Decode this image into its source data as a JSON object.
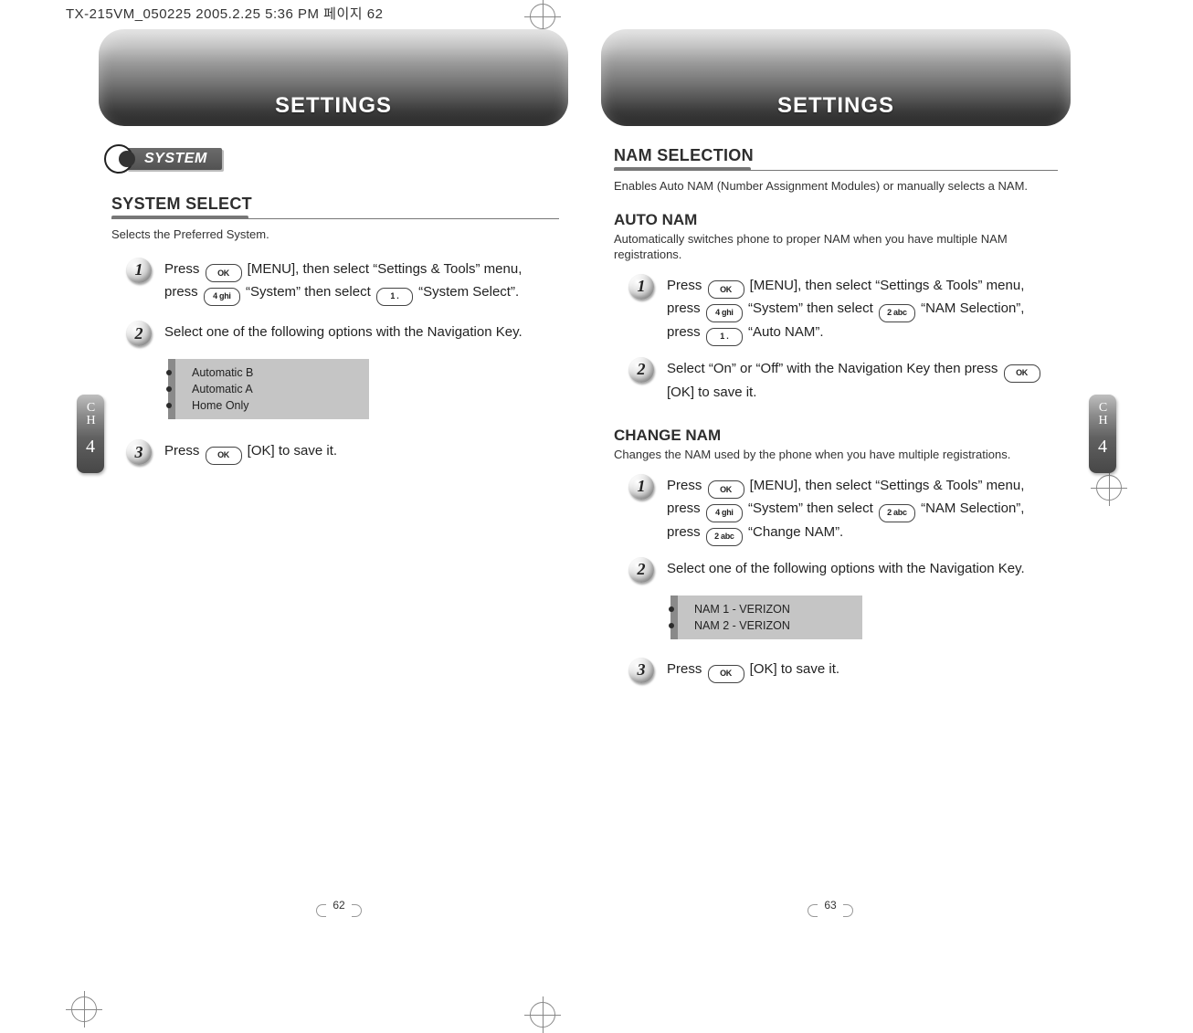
{
  "header_text": "TX-215VM_050225  2005.2.25 5:36 PM  페이지 62",
  "chapter_label": {
    "ch_line1": "C",
    "ch_line2": "H",
    "num": "4"
  },
  "left": {
    "banner": "SETTINGS",
    "section_tag": "SYSTEM",
    "sec_heading": "SYSTEM SELECT",
    "sec_desc": "Selects the Preferred System.",
    "step1": {
      "num": "1",
      "t1": "Press ",
      "t2": " [MENU], then select “Settings & Tools” menu, press ",
      "t3": " “System” then select ",
      "t4": " “System Select”."
    },
    "step2": {
      "num": "2",
      "text": "Select one of the following options with the Navigation Key."
    },
    "options": [
      "Automatic B",
      "Automatic A",
      "Home Only"
    ],
    "step3": {
      "num": "3",
      "t1": "Press ",
      "t2": " [OK] to save it."
    },
    "page_num": "62"
  },
  "right": {
    "banner": "SETTINGS",
    "sec_heading": "NAM SELECTION",
    "sec_desc": "Enables Auto NAM (Number Assignment Modules) or manually selects a NAM.",
    "auto_nam": {
      "heading": "AUTO NAM",
      "desc": "Automatically switches phone to proper NAM when you have multiple NAM registrations.",
      "step1": {
        "num": "1",
        "t1": "Press ",
        "t2": " [MENU], then select “Settings & Tools” menu, press ",
        "t3": " “System” then select ",
        "t4": " “NAM Selection”, press ",
        "t5": " “Auto NAM”."
      },
      "step2": {
        "num": "2",
        "t1": "Select “On” or “Off” with the Navigation Key then press ",
        "t2": " [OK] to save it."
      }
    },
    "change_nam": {
      "heading": "CHANGE NAM",
      "desc": "Changes the NAM used by the phone when you have multiple registrations.",
      "step1": {
        "num": "1",
        "t1": "Press ",
        "t2": " [MENU], then select “Settings & Tools” menu, press ",
        "t3": " “System” then select ",
        "t4": " “NAM Selection”, press ",
        "t5": " “Change NAM”."
      },
      "step2": {
        "num": "2",
        "text": "Select one of the following options with the Navigation Key."
      },
      "options": [
        "NAM 1 - VERIZON",
        "NAM 2 - VERIZON"
      ],
      "step3": {
        "num": "3",
        "t1": "Press ",
        "t2": " [OK] to save it."
      }
    },
    "page_num": "63"
  }
}
